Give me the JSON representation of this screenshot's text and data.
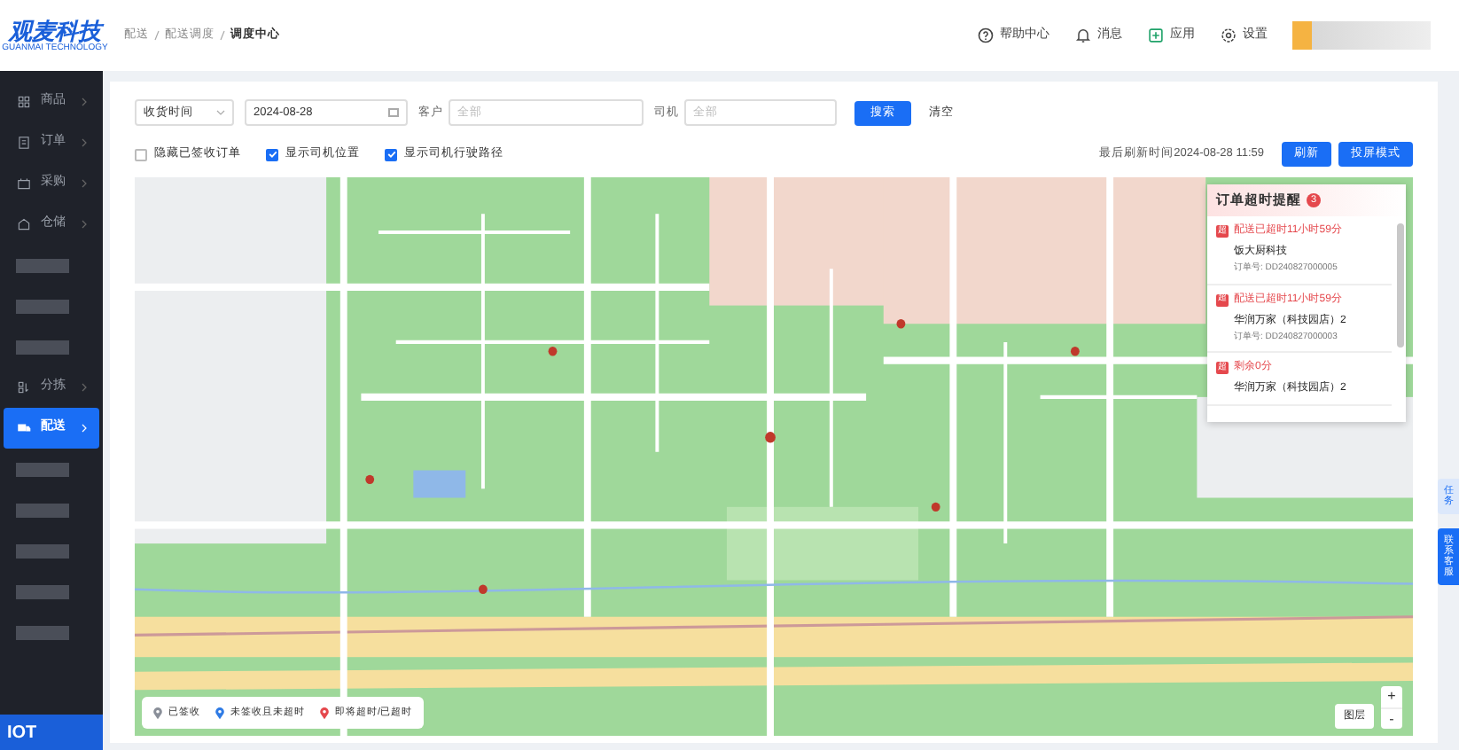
{
  "logo": {
    "title": "观麦科技",
    "subtitle": "GUANMAI TECHNOLOGY"
  },
  "breadcrumb": [
    {
      "label": "配送"
    },
    {
      "label": "配送调度"
    },
    {
      "label": "调度中心"
    }
  ],
  "header_actions": [
    {
      "label": "帮助中心",
      "kind": "help"
    },
    {
      "label": "消息",
      "kind": "bell"
    },
    {
      "label": "应用",
      "kind": "app"
    },
    {
      "label": "设置",
      "kind": "gear"
    }
  ],
  "sidebar": {
    "items": [
      {
        "label": "商品",
        "kind": "grid",
        "selected": false
      },
      {
        "label": "订单",
        "kind": "doc",
        "selected": false
      },
      {
        "label": "采购",
        "kind": "cart",
        "selected": false
      },
      {
        "label": "仓储",
        "kind": "house",
        "selected": false
      },
      {
        "kind": "redacted"
      },
      {
        "kind": "redacted"
      },
      {
        "kind": "redacted"
      },
      {
        "label": "分拣",
        "kind": "sort",
        "selected": false
      },
      {
        "label": "配送",
        "kind": "truck",
        "selected": true
      },
      {
        "kind": "redacted"
      },
      {
        "kind": "redacted"
      },
      {
        "kind": "redacted"
      },
      {
        "kind": "redacted"
      },
      {
        "kind": "redacted"
      }
    ],
    "footer": "IOT"
  },
  "filters": {
    "time_type": "收货时间",
    "date": "2024-08-28",
    "customer_label": "客户",
    "customer_placeholder": "全部",
    "driver_label": "司机",
    "driver_placeholder": "全部",
    "search_button": "搜索",
    "clear_link": "清空"
  },
  "options": [
    {
      "label": "隐藏已签收订单",
      "checked": false
    },
    {
      "label": "显示司机位置",
      "checked": true
    },
    {
      "label": "显示司机行驶路径",
      "checked": true
    }
  ],
  "last_refresh": "最后刷新时间2024-08-28 11:59",
  "buttons": [
    "刷新",
    "投屏模式"
  ],
  "alerts": {
    "title": "订单超时提醒",
    "count": "3",
    "items": [
      {
        "badge": "超",
        "status": "配送已超时11小时59分",
        "customer": "饭大厨科技",
        "order": "订单号: DD240827000005"
      },
      {
        "badge": "超",
        "status": "配送已超时11小时59分",
        "customer": "华润万家（科技园店）2",
        "order": "订单号: DD240827000003"
      },
      {
        "badge": "超",
        "status": "剩余0分",
        "customer": "华润万家（科技园店）2"
      }
    ]
  },
  "legend": [
    {
      "label": "已签收",
      "color": "#8a8f99"
    },
    {
      "label": "未签收且未超时",
      "color": "#2f7be5"
    },
    {
      "label": "即将超时/已超时",
      "color": "#e5484d"
    }
  ],
  "map_controls": {
    "layer": "图层",
    "zoom_in": "+",
    "zoom_out": "-"
  },
  "side_tabs": [
    {
      "label": "任务",
      "kind": "light"
    },
    {
      "label": "联系客服",
      "kind": "solid"
    }
  ]
}
